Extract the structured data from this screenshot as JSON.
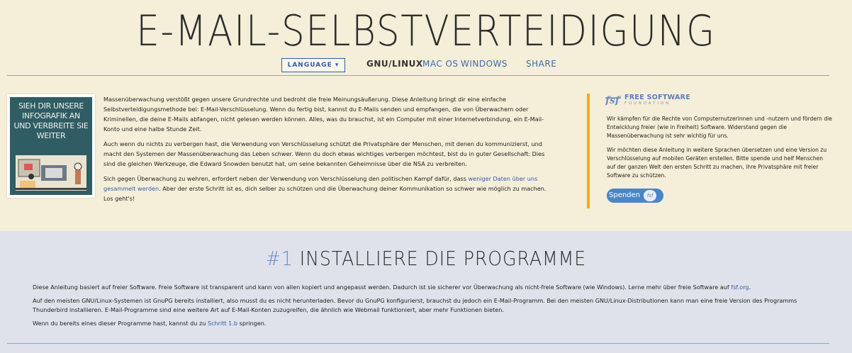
{
  "header": {
    "title": "E-MAIL-SELBSTVERTEIDIGUNG",
    "language_button": "LANGUAGE ▾",
    "nav": {
      "current": "GNU/LINUX",
      "macos": "MAC OS",
      "windows": "WINDOWS",
      "share": "SHARE"
    }
  },
  "infographic": {
    "text": "SIEH DIR UNSERE INFOGRAFIK AN UND VERBREITE SIE WEITER"
  },
  "intro": {
    "p1": "Massenüberwachung verstößt gegen unsere Grundrechte und bedroht die freie Meinungsäußerung. Diese Anleitung bringt dir eine einfache Selbstverteidigungsmethode bei: E-Mail-Verschlüsselung. Wenn du fertig bist, kannst du E-Mails senden und empfangen, die von Überwachern oder Kriminellen, die deine E-Mails abfangen, nicht gelesen werden können. Alles, was du brauchst, ist ein Computer mit einer Internetverbindung, ein E-Mail-Konto und eine halbe Stunde Zeit.",
    "p2": "Auch wenn du nichts zu verbergen hast, die Verwendung von Verschlüsselung schützt die Privatsphäre der Menschen, mit denen du kommunizierst, und macht den Systemen der Massenüberwachung das Leben schwer. Wenn du doch etwas wichtiges verbergen möchtest, bist du in guter Gesellschaft: Dies sind die gleichen Werkzeuge, die Edward Snowden benutzt hat, um seine bekannten Geheimnisse über die NSA zu verbreiten.",
    "p3_before": "Sich gegen Überwachung zu wehren, erfordert neben der Verwendung von Verschlüsselung den politischen Kampf dafür, dass ",
    "p3_link": "weniger Daten über uns gesammelt werden",
    "p3_after": ". Aber der erste Schritt ist es, dich selber zu schützen und die Überwachung deiner Kommunikation so schwer wie möglich zu machen. Los geht's!"
  },
  "fsf": {
    "logo_text_1": "FREE SOFTWARE",
    "logo_text_2": "FOUNDATION",
    "p1": "Wir kämpfen für die Rechte von Computernutzerinnen und -nutzern und fördern die Entwicklung freier (wie in Freiheit) Software. Widerstand gegen die Massenüberwachung ist sehr wichtig für uns.",
    "p2": "Wir möchten diese Anleitung in weitere Sprachen übersetzen und eine Version zu Verschlüsselung auf mobilen Geräten erstellen. Bitte spende und helf Menschen auf der ganzen Welt den ersten Schritt zu machen, ihre Privatsphäre mit freier Software zu schützen.",
    "donate": "Spenden",
    "donate_knob": "fsf"
  },
  "section1": {
    "number": "#1",
    "title": "INSTALLIERE DIE PROGRAMME",
    "p1_before": "Diese Anleitung basiert auf freier Software. Freie Software ist transparent und kann von allen kopiert und angepasst werden. Dadurch ist sie sicherer vor Überwachung als nicht-freie Software (wie Windows). Lerne mehr über freie Software auf ",
    "p1_link": "fsf.org",
    "p1_after": ".",
    "p2": "Auf den meisten GNU/Linux-Systemen ist GnuPG bereits installiert, also musst du es nicht herunterladen. Bevor du GnuPG konfigurierst, brauchst du jedoch ein E-Mail-Programm. Bei den meisten GNU/Linux-Distributionen kann man eine freie Version des Programms Thunderbird installieren. E-Mail-Programme sind eine weitere Art auf E-Mail-Konten zuzugreifen, die ähnlich wie Webmail funktioniert, aber mehr Funktionen bieten.",
    "p3_before": "Wenn du bereits eines dieser Programme hast, kannst du zu ",
    "p3_link": "Schritt 1.b",
    "p3_after": " springen."
  },
  "colors": {
    "background": "#f5eed8",
    "section_bg": "#dfe2ea",
    "link": "#2f5fa8",
    "accent_orange": "#f6a623",
    "donate_blue": "#4a86c8"
  }
}
